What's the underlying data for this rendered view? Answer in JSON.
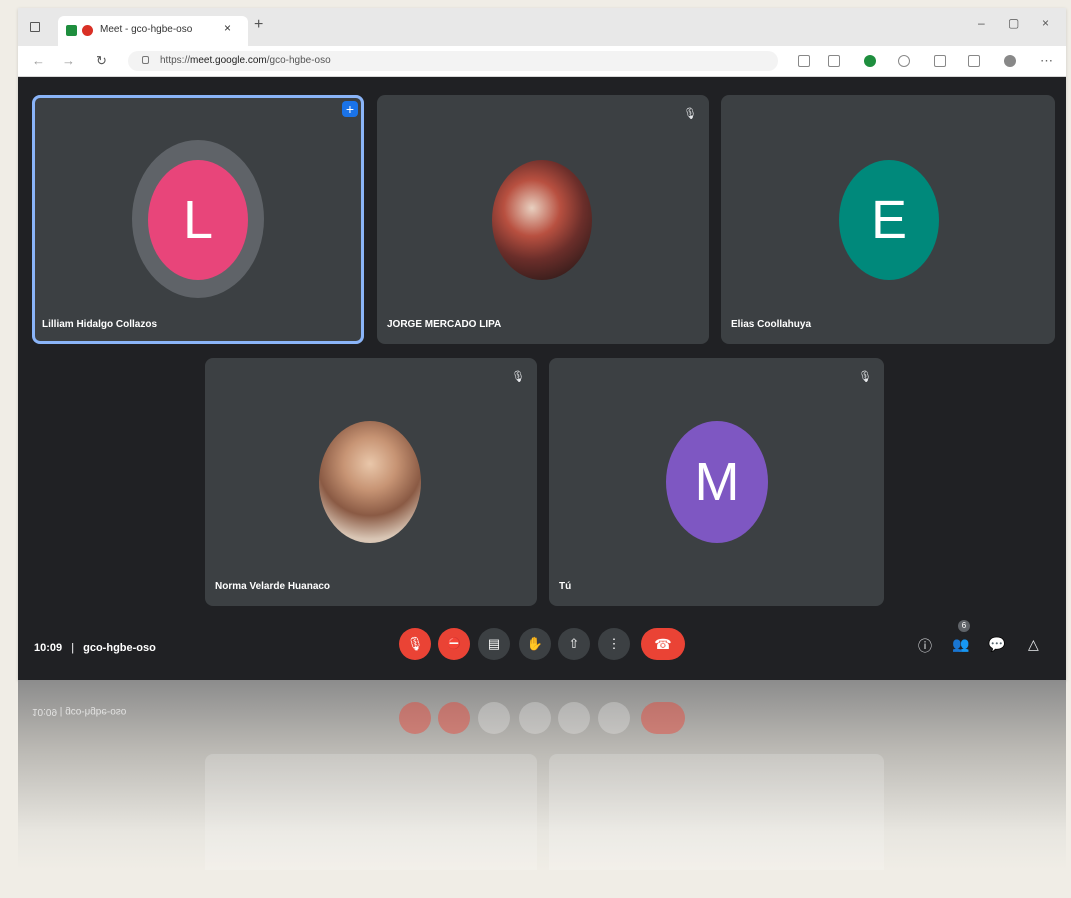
{
  "browser": {
    "tab_title": "Meet - gco-hgbe-oso",
    "tab_close": "×",
    "new_tab": "+",
    "url_prefix": "https://",
    "url_host": "meet.google.com",
    "url_path": "/gco-hgbe-oso",
    "controls": {
      "minimize": "–",
      "maximize": "▢",
      "close": "×"
    }
  },
  "participants": [
    {
      "name": "Lilliam Hidalgo Collazos",
      "initial": "L",
      "color": "#e8457a",
      "pinned": true
    },
    {
      "name": "JORGE MERCADO LIPA",
      "initial": "",
      "photo": true
    },
    {
      "name": "Elias Coollahuya",
      "initial": "E",
      "color": "#00897b"
    },
    {
      "name": "Norma Velarde Huanaco",
      "initial": "",
      "photo": true
    },
    {
      "name": "Tú",
      "initial": "M",
      "color": "#7e57c2"
    }
  ],
  "meeting": {
    "time": "10:09",
    "code": "gco-hgbe-oso"
  },
  "controls": {
    "mic_icon": "🎙",
    "cam_icon": "⛔",
    "captions_icon": "▤",
    "hand_icon": "✋",
    "present_icon": "⇧",
    "more_icon": "⋮",
    "end_icon": "☎"
  },
  "right_panel": {
    "people_count": "6"
  },
  "colors": {
    "background": "#202124",
    "tile": "#3c4043",
    "red": "#ea4335",
    "active_outline": "#8ab4f8"
  }
}
